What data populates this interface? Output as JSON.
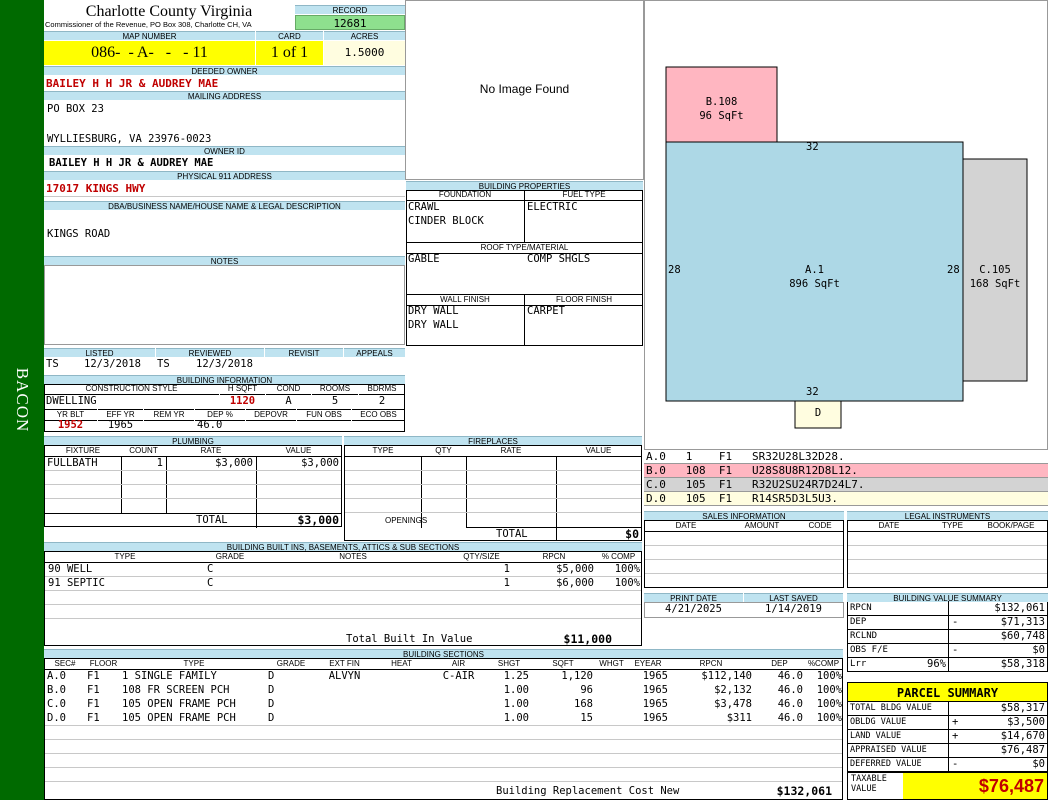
{
  "side_label": "BACON",
  "county": {
    "title": "Charlotte County Virginia",
    "subtitle": "Commissioner of the Revenue, PO Box 308, Charlotte CH, VA"
  },
  "record": {
    "label": "RECORD",
    "value": "12681"
  },
  "map": {
    "label": "MAP NUMBER",
    "value": "086-  - A-   -   - 11",
    "card_label": "CARD",
    "card": "1 of 1",
    "acres_label": "ACRES",
    "acres": "1.5000"
  },
  "owner": {
    "deeded_label": "DEEDED OWNER",
    "deeded": "BAILEY H H JR & AUDREY MAE",
    "mailing_label": "MAILING ADDRESS",
    "mailing_line1": "PO BOX 23",
    "mailing_line2": "WYLLIESBURG, VA 23976-0023",
    "owner_id_label": "OWNER ID",
    "owner_id": "BAILEY H H JR & AUDREY MAE",
    "physical_label": "PHYSICAL 911 ADDRESS",
    "physical": "17017 KINGS HWY"
  },
  "dba": {
    "label": "DBA/BUSINESS NAME/HOUSE NAME & LEGAL DESCRIPTION",
    "value": "KINGS ROAD"
  },
  "notes": {
    "label": "NOTES"
  },
  "image": {
    "placeholder": "No Image Found"
  },
  "building_properties": {
    "title": "BUILDING PROPERTIES",
    "foundation_label": "FOUNDATION",
    "foundation": [
      "CRAWL",
      "CINDER BLOCK"
    ],
    "fuel_label": "FUEL TYPE",
    "fuel": "ELECTRIC",
    "roof_label": "ROOF TYPE/MATERIAL",
    "roof_type": "GABLE",
    "roof_material": "COMP SHGLS",
    "wall_label": "WALL FINISH",
    "wall": [
      "DRY WALL",
      "DRY WALL"
    ],
    "floor_label": "FLOOR FINISH",
    "floor": "CARPET"
  },
  "dates": {
    "listed_label": "LISTED",
    "listed_by": "TS",
    "listed": "12/3/2018",
    "reviewed_label": "REVIEWED",
    "reviewed_by": "TS",
    "reviewed": "12/3/2018",
    "revisit_label": "REVISIT",
    "appeals_label": "APPEALS"
  },
  "building_info": {
    "title": "BUILDING INFORMATION",
    "style_label": "CONSTRUCTION STYLE",
    "style": "DWELLING",
    "hsqft_label": "H SQFT",
    "hsqft": "1120",
    "cond_label": "COND",
    "cond": "A",
    "rooms_label": "ROOMS",
    "rooms": "5",
    "bdrms_label": "BDRMS",
    "bdrms": "2",
    "yrblt_label": "YR BLT",
    "yrblt": "1952",
    "effyr_label": "EFF YR",
    "effyr": "1965",
    "remyr_label": "REM YR",
    "dep_label": "DEP %",
    "dep": "46.0",
    "depovr_label": "DEPOVR",
    "funobs_label": "FUN OBS",
    "ecoobs_label": "ECO OBS"
  },
  "plumbing": {
    "title": "PLUMBING",
    "cols": [
      "FIXTURE",
      "COUNT",
      "RATE",
      "VALUE"
    ],
    "rows": [
      {
        "fixture": "FULLBATH",
        "count": "1",
        "rate": "$3,000",
        "value": "$3,000"
      }
    ],
    "total_label": "TOTAL",
    "total": "$3,000"
  },
  "fireplaces": {
    "title": "FIREPLACES",
    "cols": [
      "TYPE",
      "QTY",
      "RATE",
      "VALUE"
    ],
    "openings_label": "OPENINGS",
    "total_label": "TOTAL",
    "total": "$0"
  },
  "builtins": {
    "title": "BUILDING BUILT INS, BASEMENTS, ATTICS & SUB SECTIONS",
    "cols": [
      "TYPE",
      "GRADE",
      "NOTES",
      "QTY/SIZE",
      "RPCN",
      "% COMP"
    ],
    "rows": [
      {
        "type": "90 WELL",
        "grade": "C",
        "notes": "",
        "qty": "1",
        "rpcn": "$5,000",
        "comp": "100%"
      },
      {
        "type": "91 SEPTIC",
        "grade": "C",
        "notes": "",
        "qty": "1",
        "rpcn": "$6,000",
        "comp": "100%"
      }
    ],
    "total_label": "Total Built In Value",
    "total": "$11,000"
  },
  "sections": {
    "title": "BUILDING SECTIONS",
    "cols": [
      "SEC#",
      "FLOOR",
      "TYPE",
      "GRADE",
      "EXT FIN",
      "HEAT",
      "AIR",
      "SHGT",
      "SQFT",
      "WHGT",
      "EYEAR",
      "RPCN",
      "DEP",
      "%COMP"
    ],
    "rows": [
      {
        "sec": "A.0",
        "floor": "F1",
        "type": "1 SINGLE FAMILY",
        "grade": "D",
        "ext": "ALVYN",
        "heat": "",
        "air": "C-AIR",
        "shgt": "1.25",
        "sqft": "1,120",
        "whgt": "",
        "eyear": "1965",
        "rpcn": "$112,140",
        "dep": "46.0",
        "comp": "100%"
      },
      {
        "sec": "B.0",
        "floor": "F1",
        "type": "108 FR SCREEN PCH",
        "grade": "D",
        "ext": "",
        "heat": "",
        "air": "",
        "shgt": "1.00",
        "sqft": "96",
        "whgt": "",
        "eyear": "1965",
        "rpcn": "$2,132",
        "dep": "46.0",
        "comp": "100%"
      },
      {
        "sec": "C.0",
        "floor": "F1",
        "type": "105 OPEN FRAME PCH",
        "grade": "D",
        "ext": "",
        "heat": "",
        "air": "",
        "shgt": "1.00",
        "sqft": "168",
        "whgt": "",
        "eyear": "1965",
        "rpcn": "$3,478",
        "dep": "46.0",
        "comp": "100%"
      },
      {
        "sec": "D.0",
        "floor": "F1",
        "type": "105 OPEN FRAME PCH",
        "grade": "D",
        "ext": "",
        "heat": "",
        "air": "",
        "shgt": "1.00",
        "sqft": "15",
        "whgt": "",
        "eyear": "1965",
        "rpcn": "$311",
        "dep": "46.0",
        "comp": "100%"
      }
    ],
    "total_label": "Building Replacement Cost New",
    "total": "$132,061"
  },
  "sketch": {
    "a_label": "A.1",
    "a_area": "896 SqFt",
    "b_label": "B.108",
    "b_area": "96 SqFt",
    "c_label": "C.105",
    "c_area": "168 SqFt",
    "d_label": "D",
    "dim_top": "32",
    "dim_bottom": "32",
    "dim_left": "28",
    "dim_right": "28",
    "colors": {
      "a": "#add8e6",
      "b": "#ffb6c1",
      "c": "#d3d3d3",
      "d": "#fffde0"
    }
  },
  "vectors": [
    {
      "text": "A.0   1    F1   SR32U28L32D28.",
      "color": "#ffffff"
    },
    {
      "text": "B.0   108  F1   U28S8U8R12D8L12.",
      "color": "#ffb6c1"
    },
    {
      "text": "C.0   105  F1   R32U2SU24R7D24L7.",
      "color": "#d3d3d3"
    },
    {
      "text": "D.0   105  F1   R14SR5D3L5U3.",
      "color": "#fffde0"
    }
  ],
  "sales": {
    "title": "SALES INFORMATION",
    "cols": [
      "DATE",
      "AMOUNT",
      "CODE"
    ]
  },
  "legal": {
    "title": "LEGAL INSTRUMENTS",
    "cols": [
      "DATE",
      "TYPE",
      "BOOK/PAGE"
    ]
  },
  "print": {
    "print_label": "PRINT DATE",
    "print_date": "4/21/2025",
    "saved_label": "LAST SAVED",
    "saved_date": "1/14/2019"
  },
  "value_summary": {
    "title": "BUILDING VALUE SUMMARY",
    "rows": [
      {
        "label": "RPCN",
        "sign": "",
        "value": "$132,061"
      },
      {
        "label": "DEP",
        "sign": "-",
        "value": "$71,313"
      },
      {
        "label": "RCLND",
        "sign": "",
        "value": "$60,748"
      },
      {
        "label": "OBS F/E",
        "sign": "-",
        "value": "$0"
      },
      {
        "label": "Lrr",
        "pct": "96%",
        "sign": "",
        "value": "$58,318"
      }
    ]
  },
  "parcel": {
    "title": "PARCEL SUMMARY",
    "rows": [
      {
        "label": "TOTAL BLDG VALUE",
        "sign": "",
        "value": "$58,317"
      },
      {
        "label": "OBLDG VALUE",
        "sign": "+",
        "value": "$3,500"
      },
      {
        "label": "LAND VALUE",
        "sign": "+",
        "value": "$14,670"
      },
      {
        "label": "APPRAISED VALUE",
        "sign": "",
        "value": "$76,487"
      },
      {
        "label": "DEFERRED VALUE",
        "sign": "-",
        "value": "$0"
      }
    ],
    "taxable_label": "TAXABLE VALUE",
    "taxable": "$76,487"
  }
}
